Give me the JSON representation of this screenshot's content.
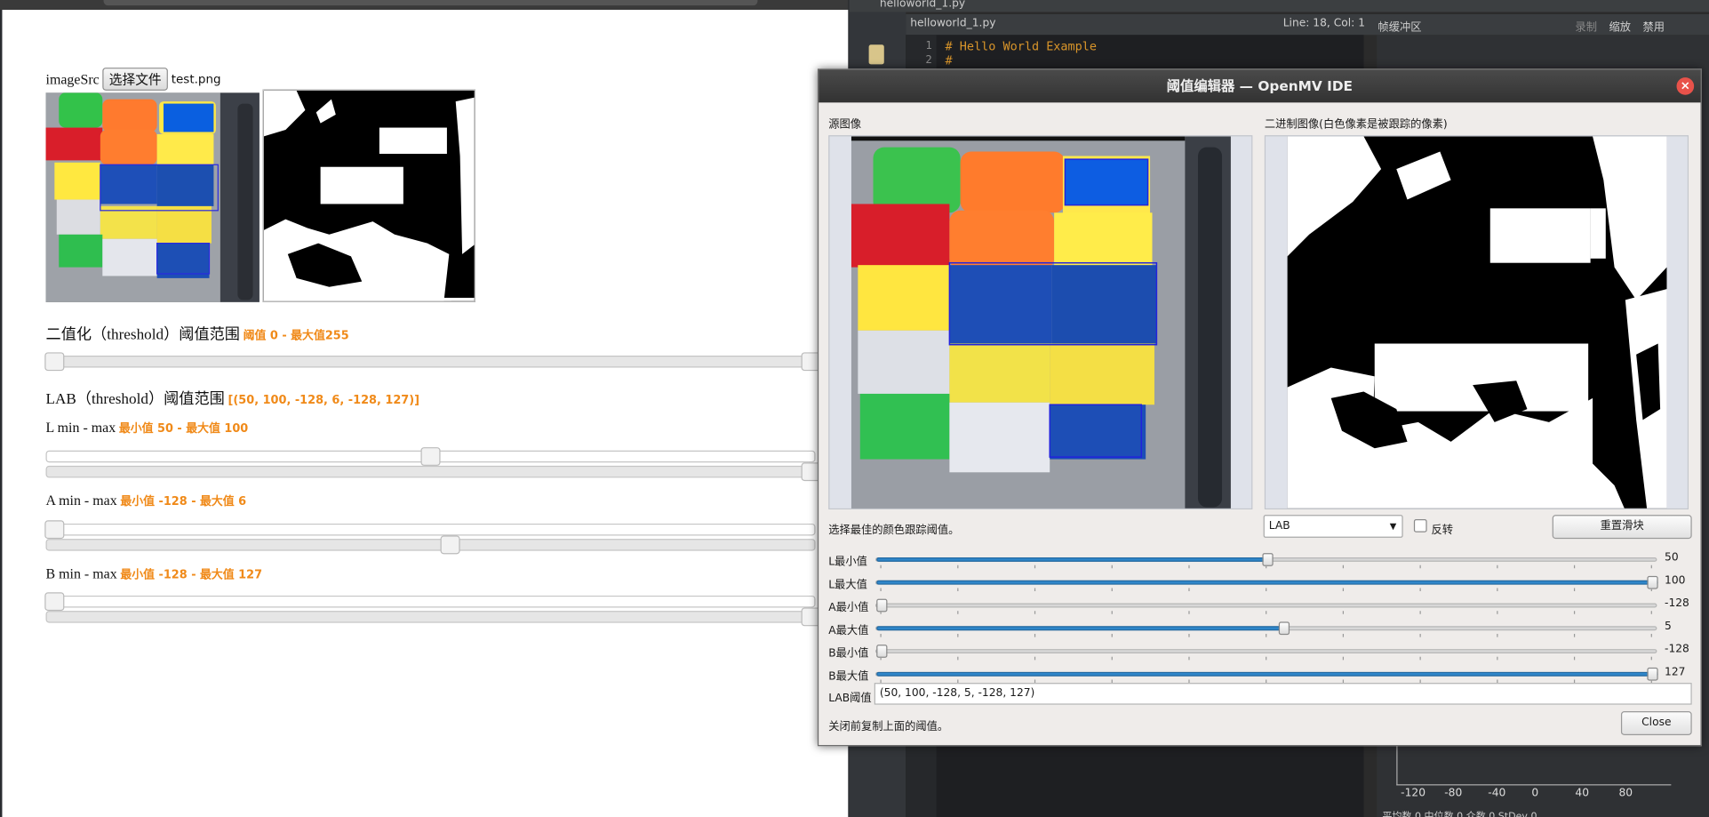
{
  "page": {
    "image_src_label": "imageSrc",
    "file_button": "选择文件",
    "file_name": "test.png",
    "threshold_title": "二值化（threshold）阈值范围",
    "threshold_hint": "阈值 0 - 最大值255",
    "lab_title": "LAB（threshold）阈值范围",
    "lab_hint": "[(50, 100, -128, 6, -128, 127)]",
    "l_title": "L min - max",
    "l_hint": "最小值 50 - 最大值 100",
    "a_title": "A min - max",
    "a_hint": "最小值 -128 - 最大值 6",
    "b_title": "B min - max",
    "b_hint": "最小值 -128 - 最大值 127"
  },
  "ide": {
    "tab_title": "helloworld_1.py",
    "file_combo": "helloworld_1.py",
    "cursor_pos": "Line: 18, Col: 1",
    "framebuffer_label": "帧缓冲区",
    "record_label": "录制",
    "zoom_label": "缩放",
    "disable_label": "禁用",
    "code_line1": "# Hello World Example",
    "code_line2": "#",
    "histogram_axis": [
      "-120",
      "-80",
      "-40",
      "0",
      "40",
      "80"
    ],
    "stats": "平均数 0     中位数 0     众数 0     StDev 0"
  },
  "dialog": {
    "title": "阈值编辑器 — OpenMV IDE",
    "source_label": "源图像",
    "binary_label": "二进制图像(白色像素是被跟踪的像素)",
    "instruction": "选择最佳的颜色跟踪阈值。",
    "color_space": "LAB",
    "invert_label": "反转",
    "reset_button": "重置滑块",
    "sliders": [
      {
        "label": "L最小值",
        "value": "50"
      },
      {
        "label": "L最大值",
        "value": "100"
      },
      {
        "label": "A最小值",
        "value": "-128"
      },
      {
        "label": "A最大值",
        "value": "5"
      },
      {
        "label": "B最小值",
        "value": "-128"
      },
      {
        "label": "B最大值",
        "value": "127"
      }
    ],
    "lab_threshold_label": "LAB阈值",
    "lab_threshold_value": "(50, 100, -128, 5, -128, 127)",
    "footer_note": "关闭前复制上面的阈值。",
    "close_button": "Close"
  },
  "colors": {
    "accent_orange": "#f08a19",
    "slider_blue": "#2f86c9",
    "close_red": "#e8524a"
  }
}
